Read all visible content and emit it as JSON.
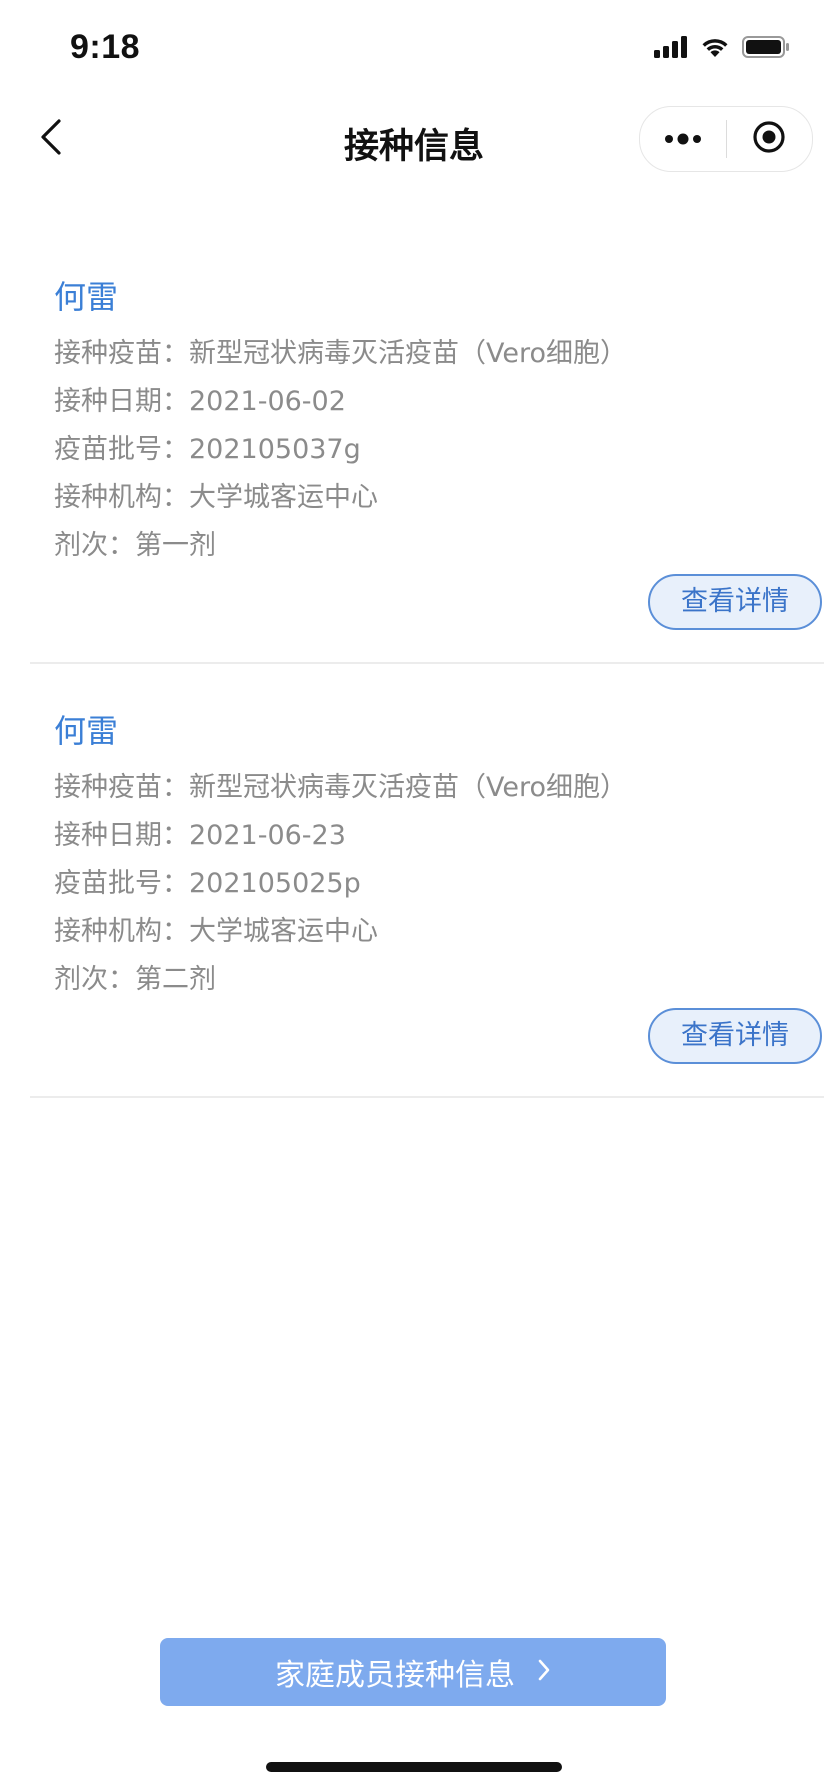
{
  "status_bar": {
    "time": "9:18",
    "icons": [
      "cellular-signal-icon",
      "wifi-icon",
      "battery-icon"
    ]
  },
  "nav": {
    "title": "接种信息",
    "back_icon": "chevron-left-icon",
    "more_icon": "more-dots-icon",
    "close_icon": "target-circle-icon"
  },
  "records": [
    {
      "name": "何雷",
      "fields": [
        "接种疫苗：新型冠状病毒灭活疫苗（Vero细胞）",
        "接种日期：2021-06-02",
        "疫苗批号：202105037g",
        "接种机构：大学城客运中心",
        "剂次：第一剂"
      ],
      "button": "查看详情"
    },
    {
      "name": "何雷",
      "fields": [
        "接种疫苗：新型冠状病毒灭活疫苗（Vero细胞）",
        "接种日期：2021-06-23",
        "疫苗批号：202105025p",
        "接种机构：大学城客运中心",
        "剂次：第二剂"
      ],
      "button": "查看详情"
    }
  ],
  "footer": {
    "family_button": "家庭成员接种信息",
    "family_button_icon": "chevron-right-icon"
  },
  "colors": {
    "accent_blue": "#3b7fd6",
    "button_fill": "#e8f0fb",
    "footer_button": "#7eaaee",
    "field_gray": "#8b8b8b"
  }
}
